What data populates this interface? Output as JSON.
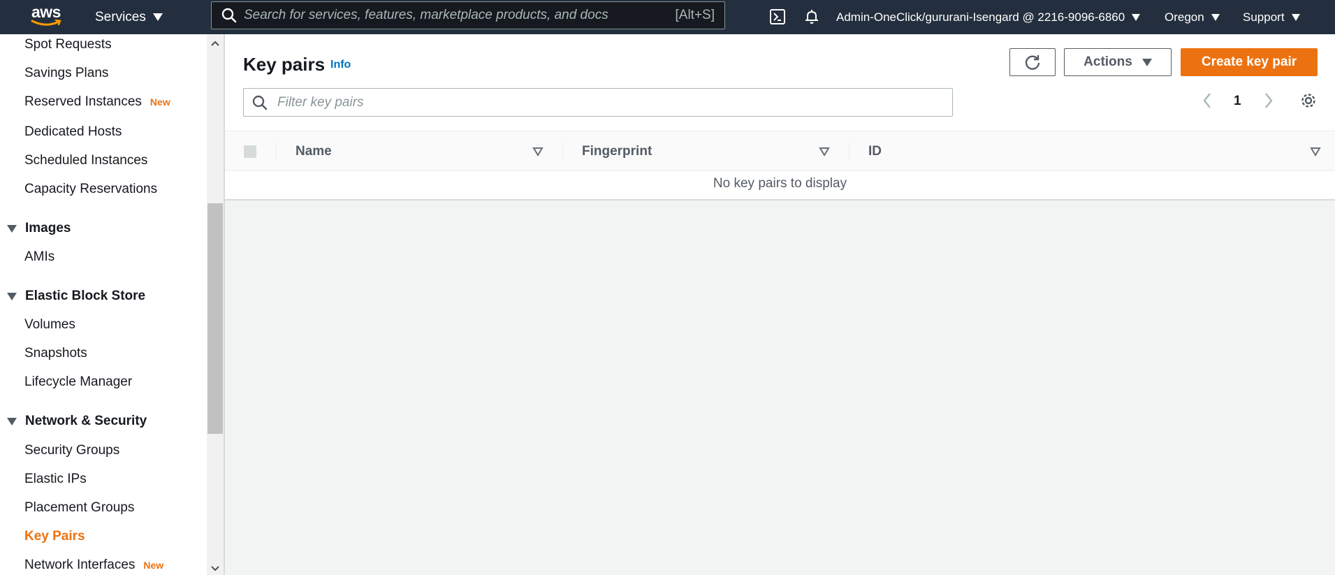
{
  "topnav": {
    "logo_text": "aws",
    "services_label": "Services",
    "search_placeholder": "Search for services, features, marketplace products, and docs",
    "search_shortcut": "[Alt+S]",
    "account_label": "Admin-OneClick/gururani-Isengard @ 2216-9096-6860",
    "region_label": "Oregon",
    "support_label": "Support"
  },
  "sidebar": {
    "items_top": [
      {
        "label": "Spot Requests"
      },
      {
        "label": "Savings Plans"
      },
      {
        "label": "Reserved Instances",
        "badge": "New"
      },
      {
        "label": "Dedicated Hosts"
      },
      {
        "label": "Scheduled Instances"
      },
      {
        "label": "Capacity Reservations"
      }
    ],
    "images": {
      "heading": "Images",
      "items": [
        {
          "label": "AMIs"
        }
      ]
    },
    "ebs": {
      "heading": "Elastic Block Store",
      "items": [
        {
          "label": "Volumes"
        },
        {
          "label": "Snapshots"
        },
        {
          "label": "Lifecycle Manager"
        }
      ]
    },
    "netsec": {
      "heading": "Network & Security",
      "items": [
        {
          "label": "Security Groups"
        },
        {
          "label": "Elastic IPs"
        },
        {
          "label": "Placement Groups"
        },
        {
          "label": "Key Pairs"
        },
        {
          "label": "Network Interfaces",
          "badge": "New"
        }
      ]
    }
  },
  "main": {
    "title": "Key pairs",
    "info_label": "Info",
    "actions_label": "Actions",
    "create_label": "Create key pair",
    "filter_placeholder": "Filter key pairs",
    "page_number": "1",
    "columns": [
      "Name",
      "Fingerprint",
      "ID"
    ],
    "empty_message": "No key pairs to display"
  },
  "colors": {
    "nav_bg": "#232f3e",
    "accent": "#ec7211",
    "link": "#0073bb"
  }
}
